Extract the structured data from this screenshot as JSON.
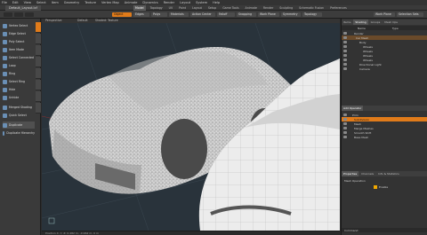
{
  "menubar": [
    "File",
    "Edit",
    "View",
    "Select",
    "Item",
    "Geometry",
    "Texture",
    "Vertex Map",
    "Animate",
    "Dynamics",
    "Render",
    "Layout",
    "System",
    "Help"
  ],
  "layout_tabs": [
    "Model",
    "Topology",
    "UV",
    "Paint",
    "Layout",
    "Setup",
    "Game Tools",
    "Animate",
    "Render",
    "Sculpting",
    "Schematic Fusion",
    "Preferences"
  ],
  "active_layout_tab": "Model",
  "window_tab": "Default_Layout.lxf",
  "toolbar": {
    "items": [
      "Object",
      "Edges",
      "Polys",
      "Materials",
      "Action Center",
      "Falloff",
      "Snapping",
      "Work Plane",
      "Symmetry",
      "Topology"
    ],
    "active": "Object",
    "right_items": [
      "Work Plane",
      "Selection Sets"
    ]
  },
  "left_tools": [
    {
      "label": "Vertex Select"
    },
    {
      "label": "Edge Select"
    },
    {
      "label": "Poly Select"
    },
    {
      "label": "Item Mode"
    },
    {
      "label": "Select Connected"
    },
    {
      "label": "Loop"
    },
    {
      "label": "Ring"
    },
    {
      "label": "Select Ring"
    },
    {
      "label": "Hide"
    },
    {
      "label": "Unhide"
    },
    {
      "label": "Merged Shading"
    },
    {
      "label": "Quick Select"
    },
    {
      "label": "Duplicate"
    },
    {
      "label": "Duplicate Hierarchy"
    }
  ],
  "viewport": {
    "header_left": "Perspective",
    "header_mid": "Default",
    "header_right": "Shaded: Texture",
    "status": "Position X, Y, Z: 0.482 m, -0.962 m, 0 m"
  },
  "right_panel": {
    "top_tabs": [
      "Items",
      "Shading",
      "Groups",
      "Mesh Ops"
    ],
    "active_top_tab": "Shading",
    "items_header": [
      "Name",
      "Type"
    ],
    "items": [
      {
        "name": "Render",
        "sel": false
      },
      {
        "name": "Car Mesh",
        "sel": true
      },
      {
        "name": "Body",
        "sel": false
      },
      {
        "name": "Wheels",
        "sel": false
      },
      {
        "name": "Wheels",
        "sel": false
      },
      {
        "name": "Wheels",
        "sel": false
      },
      {
        "name": "Wheels",
        "sel": false
      },
      {
        "name": "Directional Light",
        "sel": false
      },
      {
        "name": "Camera",
        "sel": false
      }
    ],
    "mid_tabs": [
      "Add Operator"
    ],
    "layers": [
      {
        "name": "Prim",
        "kind": "normal"
      },
      {
        "name": "Subdivision",
        "kind": "hl"
      },
      {
        "name": "Mesh",
        "kind": "normal"
      },
      {
        "name": "Merge Meshes",
        "kind": "normal"
      },
      {
        "name": "Smooth Shift",
        "kind": "normal"
      },
      {
        "name": "Base Mesh",
        "kind": "normal"
      }
    ],
    "bottom_tabs": [
      "Properties",
      "Channels",
      "Info & Statistics"
    ],
    "active_bottom_tab": "Properties",
    "prop_section": "Mesh Operation",
    "prop_label": "Enable",
    "bottom_label": "Command"
  },
  "colors": {
    "accent": "#e07b1a",
    "viewport_bg": "#29333b",
    "panel": "#333333"
  }
}
